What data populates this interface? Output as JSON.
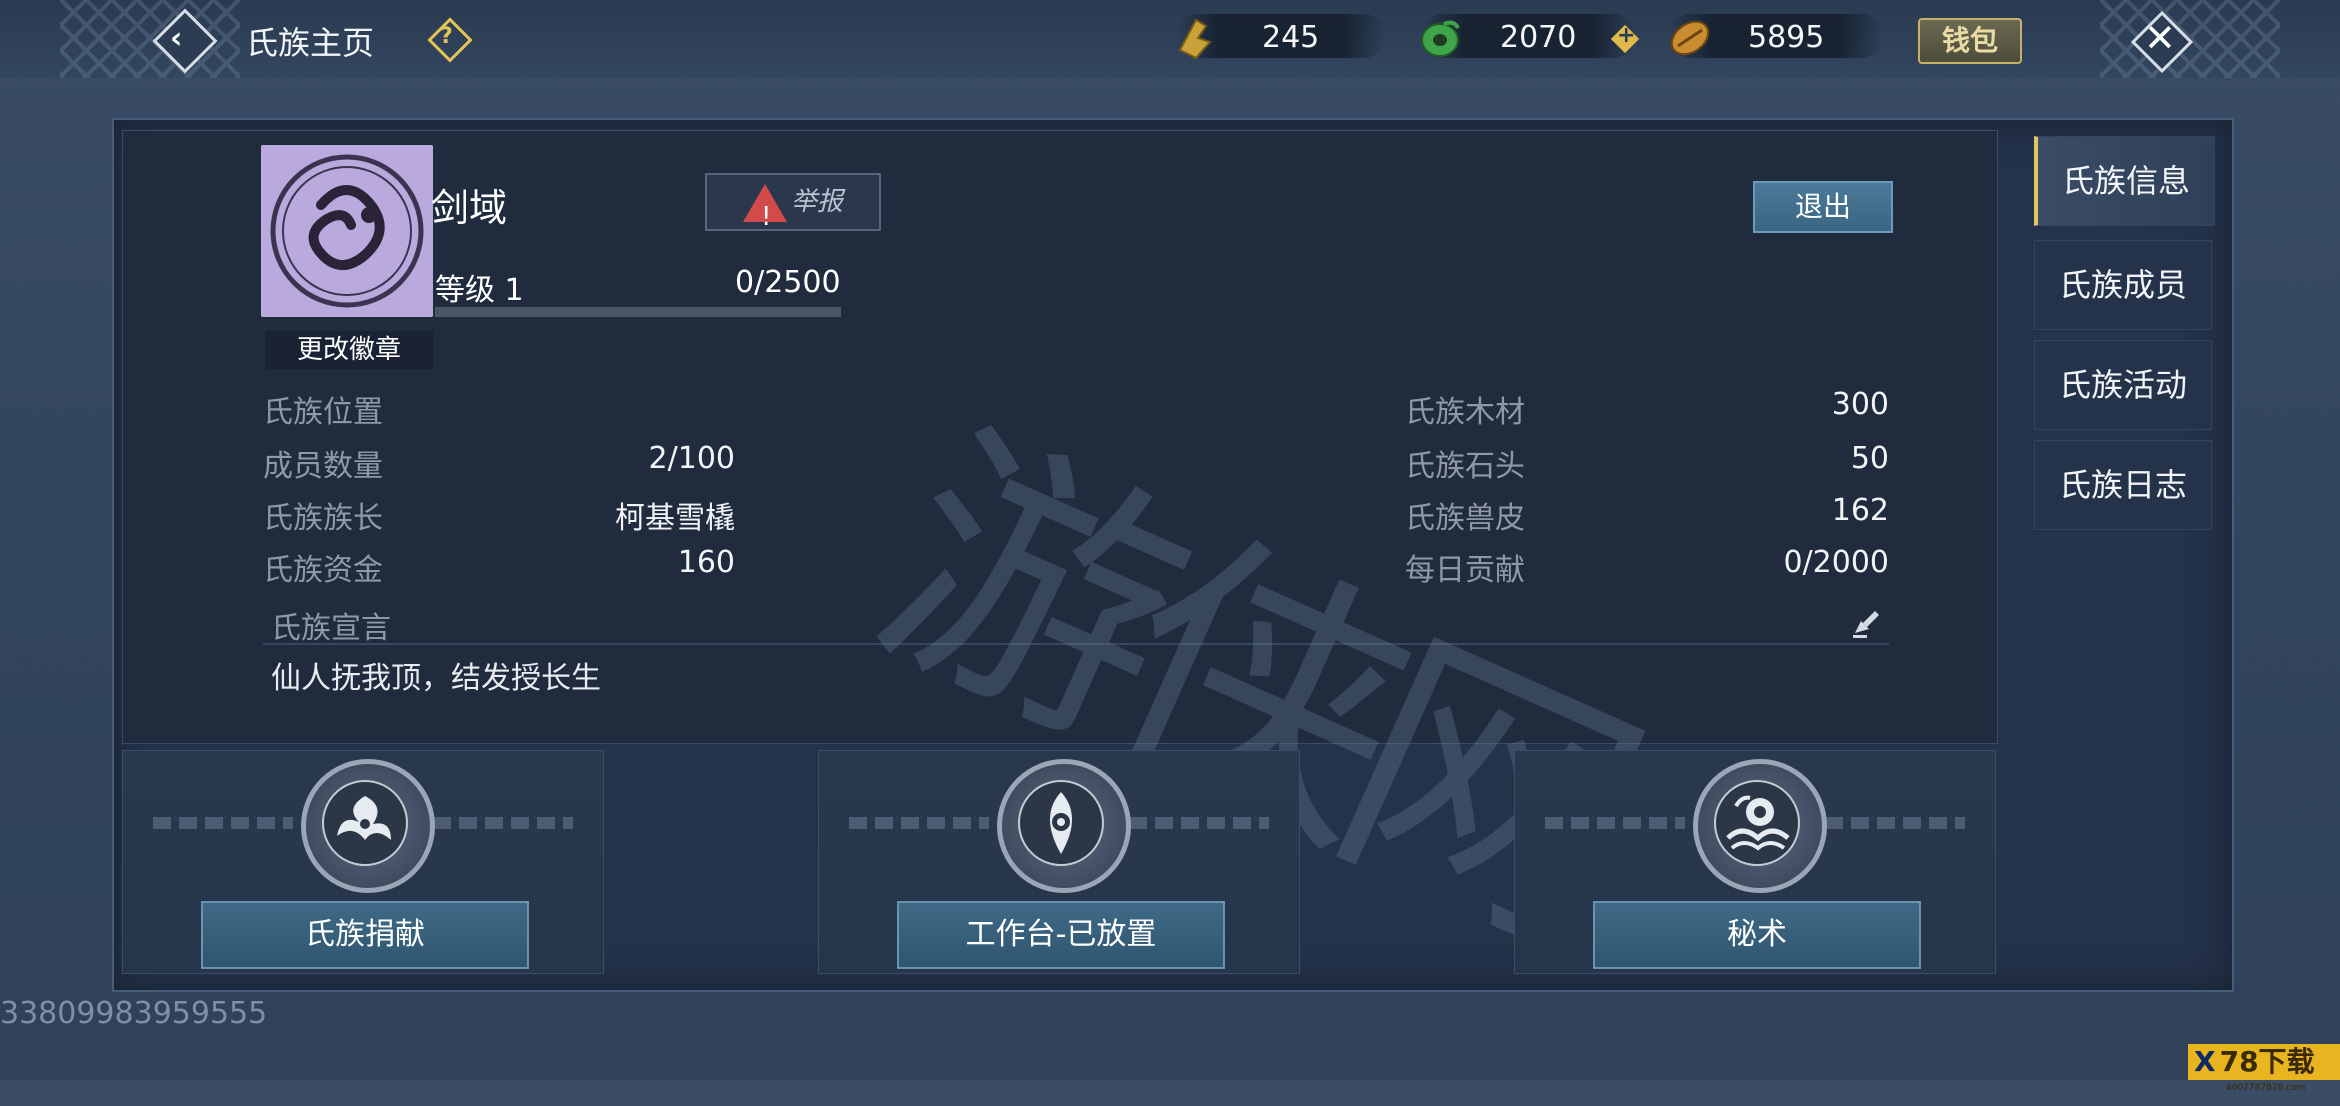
{
  "header": {
    "title": "氏族主页",
    "help_label": "?",
    "currencies": [
      {
        "icon": "gold-ingot-icon",
        "value": "245"
      },
      {
        "icon": "jade-coin-icon",
        "value": "2070"
      },
      {
        "icon": "shell-coin-icon",
        "value": "5895"
      }
    ],
    "plus_label": "+",
    "wallet_label": "钱包"
  },
  "clan": {
    "name": "剑域",
    "change_emblem_label": "更改徽章",
    "report_label": "举报",
    "exit_label": "退出",
    "level_label": "等级 1",
    "level_progress": "0/2500",
    "level_fraction": 0.0
  },
  "stats_left": [
    {
      "label": "氏族位置",
      "value": ""
    },
    {
      "label": "成员数量",
      "value": "2/100"
    },
    {
      "label": "氏族族长",
      "value": "柯基雪橇"
    },
    {
      "label": "氏族资金",
      "value": "160"
    }
  ],
  "stats_right": [
    {
      "label": "氏族木材",
      "value": "300"
    },
    {
      "label": "氏族石头",
      "value": "50"
    },
    {
      "label": "氏族兽皮",
      "value": "162"
    },
    {
      "label": "每日贡献",
      "value": "0/2000"
    }
  ],
  "declaration": {
    "label": "氏族宣言",
    "text": "仙人抚我顶，结发授长生"
  },
  "features": [
    {
      "label": "氏族捐献",
      "icon": "swirl-emblem-icon"
    },
    {
      "label": "工作台-已放置",
      "icon": "eye-emblem-icon"
    },
    {
      "label": "秘术",
      "icon": "beast-emblem-icon"
    }
  ],
  "tabs": [
    {
      "label": "氏族信息",
      "active": true
    },
    {
      "label": "氏族成员",
      "active": false
    },
    {
      "label": "氏族活动",
      "active": false
    },
    {
      "label": "氏族日志",
      "active": false
    }
  ],
  "watermark": "游侠网",
  "uid": "33809983959555",
  "brand": {
    "mark": "X",
    "name": "78下载",
    "url": "4007787878.com"
  },
  "colors": {
    "accent_gold": "#e0c667",
    "button_blue": "#3f6986",
    "warn_red": "#d24a4a"
  }
}
